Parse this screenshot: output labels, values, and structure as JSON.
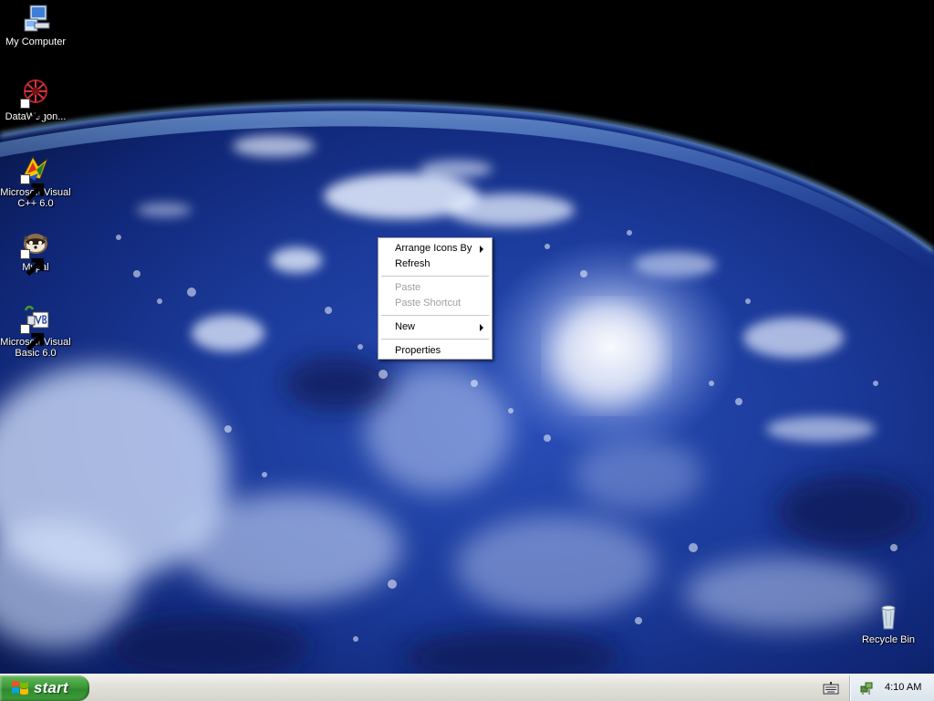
{
  "desktop": {
    "icons": [
      {
        "label": "My Computer",
        "icon": "my-computer-icon",
        "shortcut": false
      },
      {
        "label": "DataWagon...",
        "icon": "datawagon-icon",
        "shortcut": true
      },
      {
        "label": "Microsoft Visual\nC++ 6.0",
        "icon": "visual-cpp-icon",
        "shortcut": true
      },
      {
        "label": "Mypal",
        "icon": "mypal-icon",
        "shortcut": true
      },
      {
        "label": "Microsoft Visual\nBasic 6.0",
        "icon": "visual-basic-icon",
        "shortcut": true
      },
      {
        "label": "Recycle Bin",
        "icon": "recycle-bin-icon",
        "shortcut": false
      }
    ]
  },
  "context_menu": {
    "items": [
      {
        "label": "Arrange Icons By",
        "enabled": true,
        "submenu": true
      },
      {
        "label": "Refresh",
        "enabled": true,
        "submenu": false
      },
      {
        "label": "Paste",
        "enabled": false,
        "submenu": false
      },
      {
        "label": "Paste Shortcut",
        "enabled": false,
        "submenu": false
      },
      {
        "label": "New",
        "enabled": true,
        "submenu": true
      },
      {
        "label": "Properties",
        "enabled": true,
        "submenu": false
      }
    ]
  },
  "taskbar": {
    "start_label": "start",
    "clock": "4:10 AM",
    "tray_icons": [
      "keyboard-ime-icon",
      "network-icon"
    ]
  },
  "colors": {
    "start_green": "#3c9a38",
    "taskbar_bg": "#e2e1da",
    "menu_disabled": "#a0a0a0"
  }
}
